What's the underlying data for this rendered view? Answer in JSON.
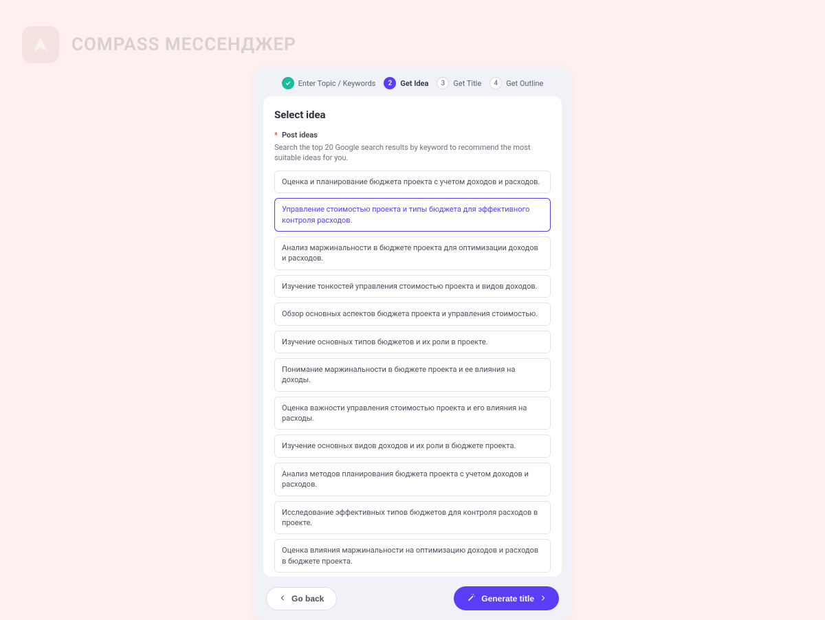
{
  "brand": {
    "name": "COMPASS МЕССЕНДЖЕР"
  },
  "steps": [
    {
      "num": "✓",
      "label": "Enter Topic / Keywords",
      "state": "done"
    },
    {
      "num": "2",
      "label": "Get Idea",
      "state": "current"
    },
    {
      "num": "3",
      "label": "Get Title",
      "state": "pending"
    },
    {
      "num": "4",
      "label": "Get Outline",
      "state": "pending"
    }
  ],
  "panel": {
    "title": "Select idea",
    "subhead": "Post ideas",
    "description": "Search the top 20 Google search results by keyword to recommend the most suitable ideas for you."
  },
  "ideas": [
    "Оценка и планирование бюджета проекта с учетом доходов и расходов.",
    "Управление стоимостью проекта и типы бюджета для эффективного контроля расходов.",
    "Анализ маржинальности в бюджете проекта для оптимизации доходов и расходов.",
    "Изучение тонкостей управления стоимостью проекта и видов доходов.",
    "Обзор основных аспектов бюджета проекта и управления стоимостью.",
    "Изучение основных типов бюджетов и их роли в проекте.",
    "Понимание маржинальности в бюджете проекта и ее влияния на доходы.",
    "Оценка важности управления стоимостью проекта и его влияния на расходы.",
    "Изучение основных видов доходов и их роли в бюджете проекта.",
    "Анализ методов планирования бюджета проекта с учетом доходов и расходов.",
    "Исследование эффективных типов бюджетов для контроля расходов в проекте.",
    "Оценка влияния маржинальности на оптимизацию доходов и расходов в бюджете проекта."
  ],
  "selected_index": 1,
  "footer": {
    "back": "Go back",
    "primary": "Generate title"
  }
}
